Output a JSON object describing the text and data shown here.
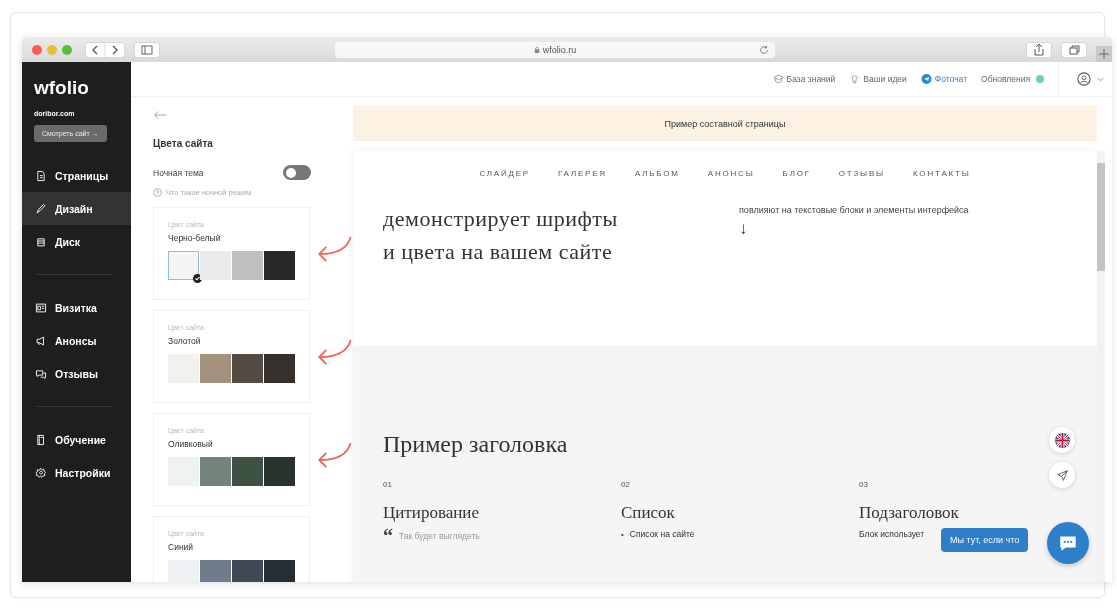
{
  "browser": {
    "url": "wfolio.ru"
  },
  "sidebar": {
    "logo": "wfolio",
    "domain": "doribor.com",
    "view_button": "Смотреть сайт →",
    "groups": [
      {
        "items": [
          {
            "label": "Страницы",
            "selected": false
          },
          {
            "label": "Дизайн",
            "selected": true
          },
          {
            "label": "Диск",
            "selected": false
          }
        ]
      },
      {
        "items": [
          {
            "label": "Визитка",
            "selected": false
          },
          {
            "label": "Анонсы",
            "selected": false
          },
          {
            "label": "Отзывы",
            "selected": false
          }
        ]
      },
      {
        "items": [
          {
            "label": "Обучение",
            "selected": false
          },
          {
            "label": "Настройки",
            "selected": false
          }
        ]
      }
    ]
  },
  "topbar": {
    "links": [
      {
        "label": "База знаний",
        "kind": "knowledge"
      },
      {
        "label": "Ваши идеи",
        "kind": "ideas"
      },
      {
        "label": "Фоточат",
        "kind": "chat"
      },
      {
        "label": "Обновления",
        "kind": "updates"
      }
    ]
  },
  "settings": {
    "title": "Цвета сайта",
    "night_mode": {
      "label": "Ночная тема",
      "on": false
    },
    "help": "Что такое ночной режим",
    "palettes": [
      {
        "caption": "Цвет сайта",
        "name": "Черно-белый",
        "swatches": [
          {
            "color": "#f5f5f5",
            "selected": true
          },
          {
            "color": "#ebebeb",
            "selected": false
          },
          {
            "color": "#c0c0c0",
            "selected": false
          },
          {
            "color": "#282828",
            "selected": false
          }
        ]
      },
      {
        "caption": "Цвет сайта",
        "name": "Золотой",
        "swatches": [
          {
            "color": "#f3f1ee",
            "selected": false
          },
          {
            "color": "#a3927d",
            "selected": false
          },
          {
            "color": "#544b45",
            "selected": false
          },
          {
            "color": "#35302c",
            "selected": false
          }
        ]
      },
      {
        "caption": "Цвет сайта",
        "name": "Оливковый",
        "swatches": [
          {
            "color": "#eef3f1",
            "selected": false
          },
          {
            "color": "#74837a",
            "selected": false
          },
          {
            "color": "#3e5244",
            "selected": false
          },
          {
            "color": "#28332b",
            "selected": false
          }
        ]
      },
      {
        "caption": "Цвет сайта",
        "name": "Синий",
        "swatches": [
          {
            "color": "#eef1f4",
            "selected": false
          },
          {
            "color": "#6e7c8c",
            "selected": false
          },
          {
            "color": "#3f4955",
            "selected": false
          },
          {
            "color": "#272d34",
            "selected": false
          }
        ]
      }
    ]
  },
  "preview": {
    "banner": "Пример составной страницы",
    "nav": [
      "СЛАЙДЕР",
      "ГАЛЕРЕЯ",
      "АЛЬБОМ",
      "АНОНСЫ",
      "БЛОГ",
      "ОТЗЫВЫ",
      "КОНТАКТЫ"
    ],
    "hero_lines": [
      "демонстрирует шрифты",
      "и цвета на вашем сайте"
    ],
    "hero_note": "повлияют на текстовые блоки и элементы интерфейса",
    "hero_arrow": "↓",
    "heading": "Пример заголовка",
    "columns": [
      {
        "number": "01",
        "title": "Цитирование",
        "kind": "quote",
        "mark": "“",
        "text": "Так будет выглядеть"
      },
      {
        "number": "02",
        "title": "Список",
        "kind": "list",
        "mark": "•",
        "text": "Список на сайте"
      },
      {
        "number": "03",
        "title": "Подзаголовок",
        "kind": "plain",
        "text": "Блок использует"
      }
    ]
  },
  "chat": {
    "label": "Мы тут, если что"
  }
}
